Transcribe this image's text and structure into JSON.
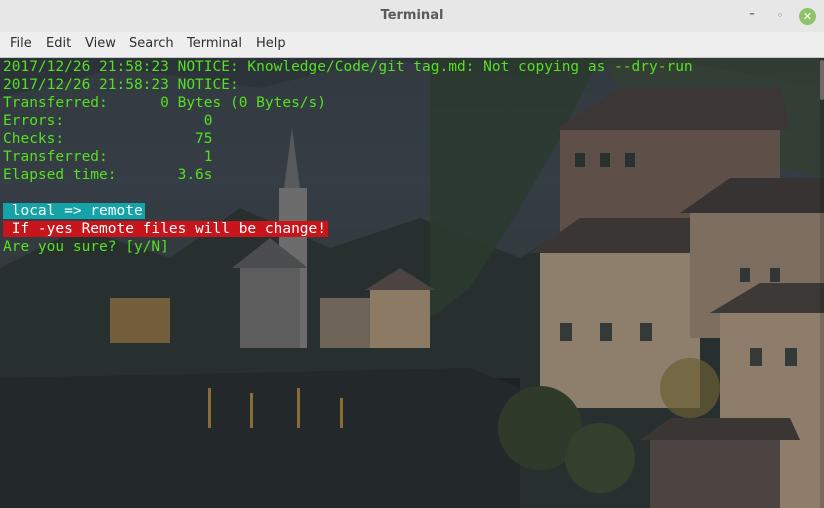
{
  "window": {
    "title": "Terminal",
    "controls": {
      "minimize": "–",
      "maximize": "◦",
      "close": "✕"
    }
  },
  "menubar": [
    "File",
    "Edit",
    "View",
    "Search",
    "Terminal",
    "Help"
  ],
  "terminal": {
    "lines": [
      "2017/12/26 21:58:23 NOTICE: Knowledge/Code/git tag.md: Not copying as --dry-run",
      "2017/12/26 21:58:23 NOTICE:",
      "Transferred:      0 Bytes (0 Bytes/s)",
      "Errors:                0",
      "Checks:               75",
      "Transferred:           1",
      "Elapsed time:       3.6s",
      "",
      " local => remote",
      " If -yes Remote files will be change!",
      "Are you sure? [y/N]"
    ],
    "text_color": "#55e022",
    "highlight_cyan": "#14a3a8",
    "highlight_red": "#c8151b"
  }
}
